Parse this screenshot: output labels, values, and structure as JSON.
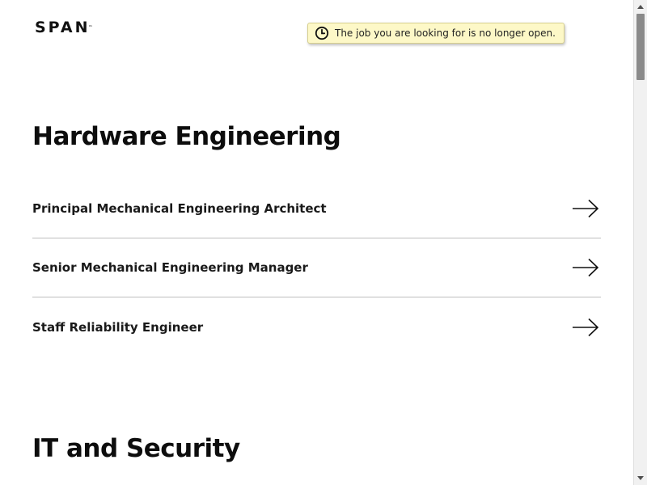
{
  "header": {
    "logo_text": "SPAN",
    "logo_tm": "™"
  },
  "notice": {
    "icon": "clock-icon",
    "text": "The job you are looking for is no longer open."
  },
  "sections": [
    {
      "title": "Hardware Engineering",
      "jobs": [
        {
          "title": "Principal Mechanical Engineering Architect",
          "icon": "arrow-right-icon"
        },
        {
          "title": "Senior Mechanical Engineering Manager",
          "icon": "arrow-right-icon"
        },
        {
          "title": "Staff Reliability Engineer",
          "icon": "arrow-right-icon"
        }
      ]
    },
    {
      "title": "IT and Security",
      "jobs": []
    }
  ],
  "colors": {
    "notice_bg": "#fdf8c7",
    "text": "#111111",
    "divider": "#bdbdbd"
  }
}
